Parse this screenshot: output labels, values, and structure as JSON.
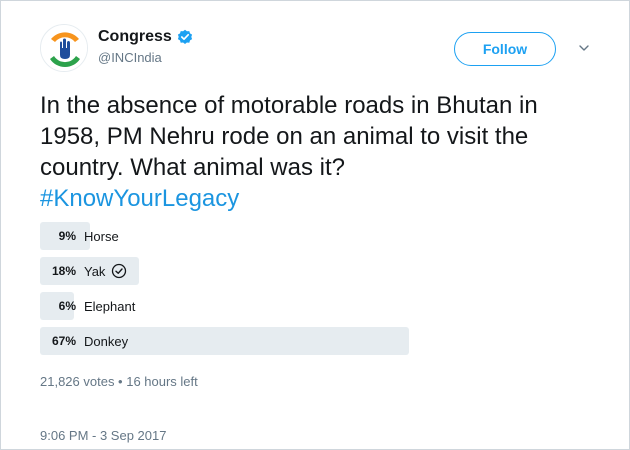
{
  "header": {
    "display_name": "Congress",
    "handle": "@INCIndia",
    "follow_label": "Follow"
  },
  "tweet": {
    "text": "In the absence of motorable roads in Bhutan in 1958, PM Nehru rode on an animal to visit the country. What animal was it?",
    "hashtag": "#KnowYourLegacy"
  },
  "poll": {
    "options": [
      {
        "percent": "9%",
        "label": "Horse",
        "value": 9,
        "selected": false
      },
      {
        "percent": "18%",
        "label": "Yak",
        "value": 18,
        "selected": true
      },
      {
        "percent": "6%",
        "label": "Elephant",
        "value": 6,
        "selected": false
      },
      {
        "percent": "67%",
        "label": "Donkey",
        "value": 67,
        "selected": false
      }
    ],
    "meta": "21,826 votes • 16 hours left"
  },
  "footer": {
    "timestamp": "9:06 PM - 3 Sep 2017"
  },
  "icons": {
    "verified": "verified-badge-icon",
    "caret": "chevron-down-icon",
    "check": "check-circle-icon"
  },
  "colors": {
    "accent": "#1da1f2",
    "hashtag": "#1b95e0",
    "muted": "#657786",
    "poll_bar": "#e6ecf0"
  }
}
